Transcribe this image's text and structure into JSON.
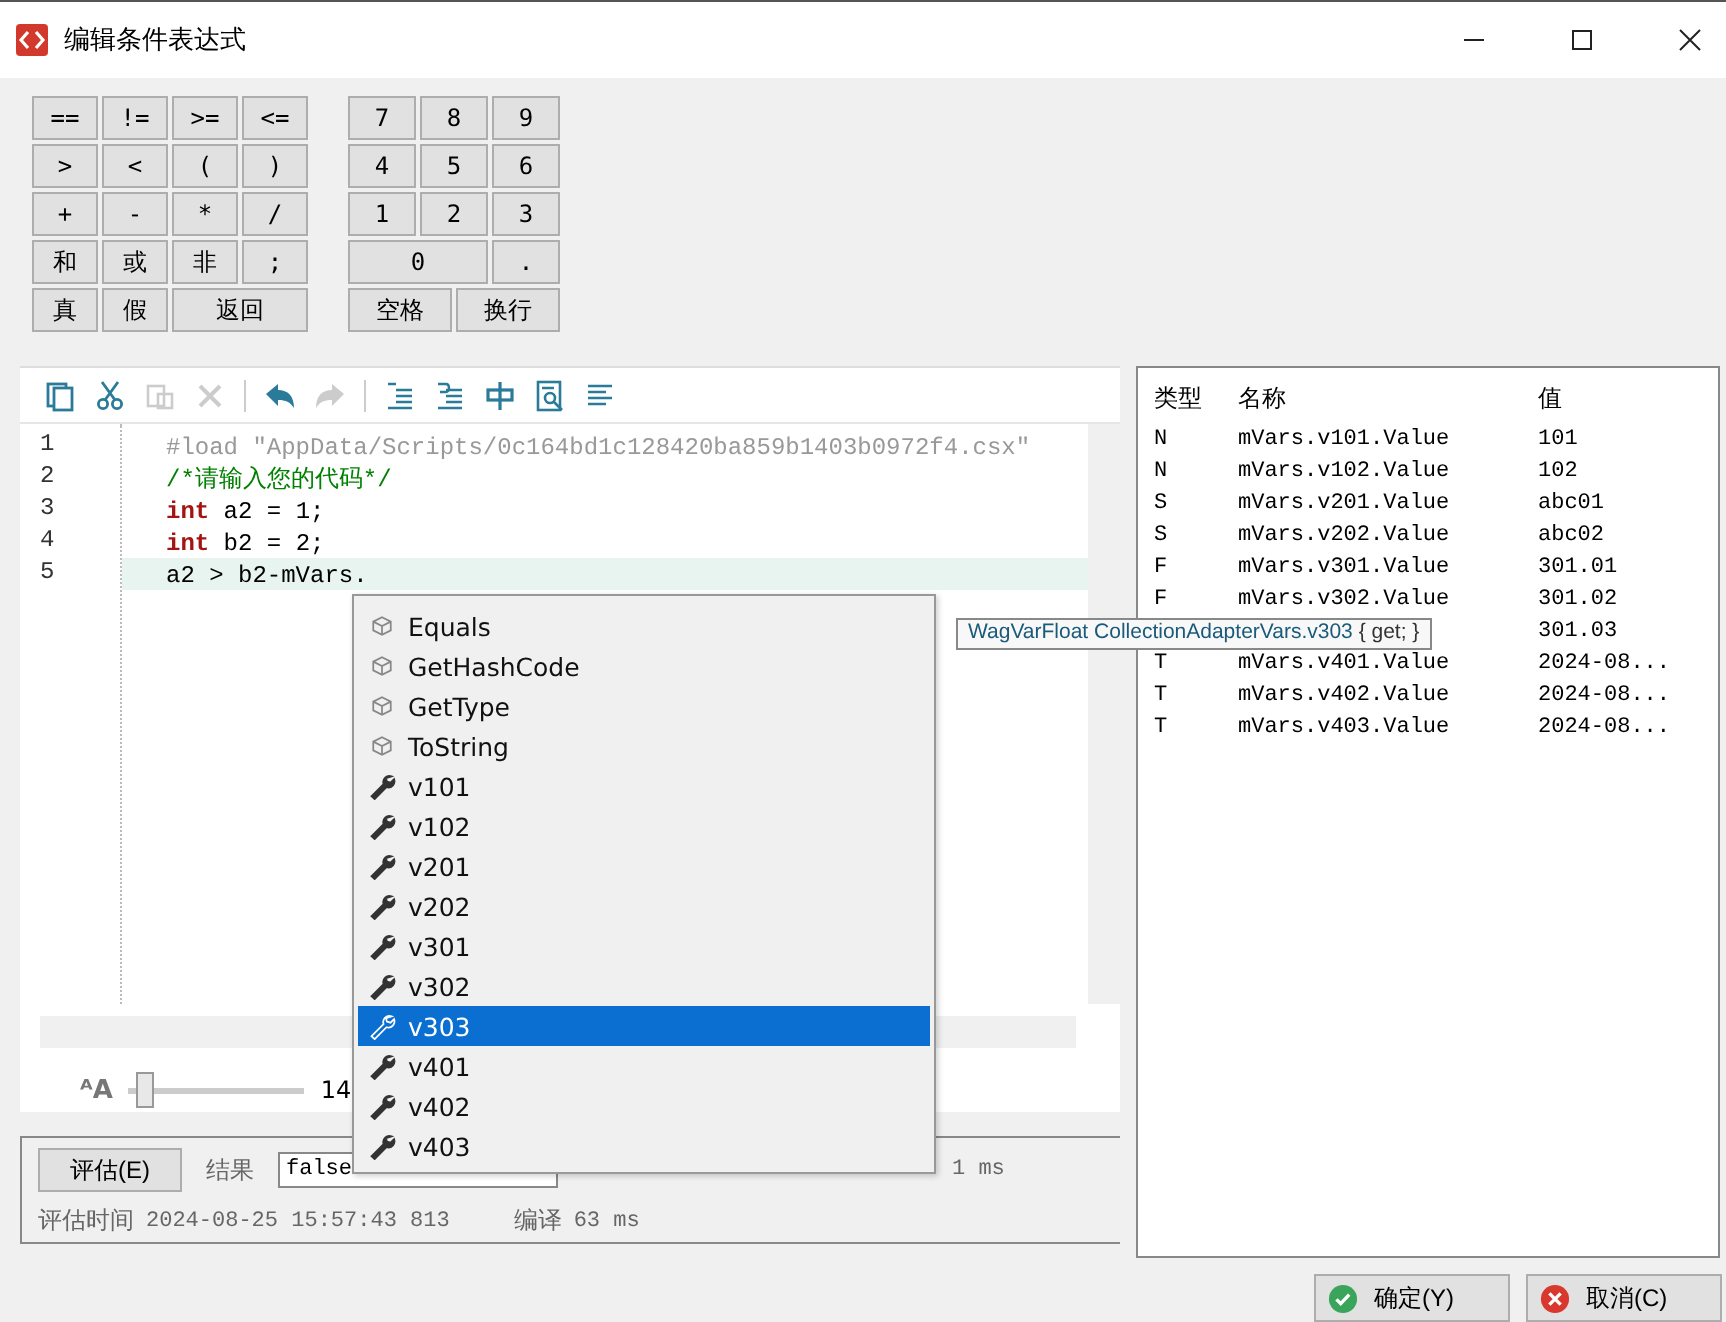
{
  "window": {
    "title": "编辑条件表达式"
  },
  "keypad_left": [
    {
      "label": "==",
      "kind": "normal"
    },
    {
      "label": "!=",
      "kind": "normal"
    },
    {
      "label": ">=",
      "kind": "normal"
    },
    {
      "label": "<=",
      "kind": "normal"
    },
    {
      "label": ">",
      "kind": "normal"
    },
    {
      "label": "<",
      "kind": "normal"
    },
    {
      "label": "(",
      "kind": "normal"
    },
    {
      "label": ")",
      "kind": "normal"
    },
    {
      "label": "+",
      "kind": "normal"
    },
    {
      "label": "-",
      "kind": "normal"
    },
    {
      "label": "*",
      "kind": "normal"
    },
    {
      "label": "/",
      "kind": "normal"
    },
    {
      "label": "和",
      "kind": "normal"
    },
    {
      "label": "或",
      "kind": "normal"
    },
    {
      "label": "非",
      "kind": "normal"
    },
    {
      "label": ";",
      "kind": "normal"
    },
    {
      "label": "真",
      "kind": "normal"
    },
    {
      "label": "假",
      "kind": "normal"
    },
    {
      "label": "返回",
      "kind": "wide"
    }
  ],
  "keypad_right": [
    {
      "label": "7",
      "kind": "normal"
    },
    {
      "label": "8",
      "kind": "normal"
    },
    {
      "label": "9",
      "kind": "normal"
    },
    {
      "label": "4",
      "kind": "normal"
    },
    {
      "label": "5",
      "kind": "normal"
    },
    {
      "label": "6",
      "kind": "normal"
    },
    {
      "label": "1",
      "kind": "normal"
    },
    {
      "label": "2",
      "kind": "normal"
    },
    {
      "label": "3",
      "kind": "normal"
    },
    {
      "label": "0",
      "kind": "wide"
    },
    {
      "label": ".",
      "kind": "normal"
    },
    {
      "label": "空格",
      "kind": "half"
    },
    {
      "label": "换行",
      "kind": "half"
    }
  ],
  "toolbar": [
    {
      "disabled": false
    },
    {
      "disabled": false
    },
    {
      "disabled": true
    },
    {
      "disabled": true
    },
    {
      "disabled": false
    },
    {
      "disabled": true
    },
    {
      "disabled": false
    },
    {
      "disabled": false
    },
    {
      "disabled": false
    },
    {
      "disabled": false
    },
    {
      "disabled": false
    }
  ],
  "editor": {
    "lines": [
      {
        "number": "1",
        "current": false,
        "tokens": [
          {
            "kind": "directive",
            "text": "#load \"AppData/Scripts/0c164bd1c128420ba859b1403b0972f4.csx\""
          }
        ]
      },
      {
        "number": "2",
        "current": false,
        "tokens": [
          {
            "kind": "comment",
            "text": "/*请输入您的代码*/"
          }
        ]
      },
      {
        "number": "3",
        "current": false,
        "tokens": [
          {
            "kind": "keyword",
            "text": "int"
          },
          {
            "kind": "plain",
            "text": " a2 = 1;"
          }
        ]
      },
      {
        "number": "4",
        "current": false,
        "tokens": [
          {
            "kind": "keyword",
            "text": "int"
          },
          {
            "kind": "plain",
            "text": " b2 = 2;"
          }
        ]
      },
      {
        "number": "5",
        "current": true,
        "tokens": [
          {
            "kind": "plain",
            "text": "a2 > b2-mVars."
          }
        ]
      }
    ],
    "font_size": {
      "icon_label": "ᴬA",
      "level": 0.04,
      "reading": "14"
    }
  },
  "completion": {
    "items": [
      {
        "label": "Equals",
        "kind": "method",
        "selected": false
      },
      {
        "label": "GetHashCode",
        "kind": "method",
        "selected": false
      },
      {
        "label": "GetType",
        "kind": "method",
        "selected": false
      },
      {
        "label": "ToString",
        "kind": "method",
        "selected": false
      },
      {
        "label": "v101",
        "kind": "property",
        "selected": false
      },
      {
        "label": "v102",
        "kind": "property",
        "selected": false
      },
      {
        "label": "v201",
        "kind": "property",
        "selected": false
      },
      {
        "label": "v202",
        "kind": "property",
        "selected": false
      },
      {
        "label": "v301",
        "kind": "property",
        "selected": false
      },
      {
        "label": "v302",
        "kind": "property",
        "selected": false
      },
      {
        "label": "v303",
        "kind": "property",
        "selected": true
      },
      {
        "label": "v401",
        "kind": "property",
        "selected": false
      },
      {
        "label": "v402",
        "kind": "property",
        "selected": false
      },
      {
        "label": "v403",
        "kind": "property",
        "selected": false
      }
    ],
    "tooltip": {
      "type": "WagVarFloat CollectionAdapterVars.v303",
      "accessor": "{ get; }"
    }
  },
  "variables": {
    "columns": [
      "类型",
      "名称",
      "值"
    ],
    "rows": [
      {
        "type": "N",
        "name": "mVars.v101.Value",
        "value": "101"
      },
      {
        "type": "N",
        "name": "mVars.v102.Value",
        "value": "102"
      },
      {
        "type": "S",
        "name": "mVars.v201.Value",
        "value": "abc01"
      },
      {
        "type": "S",
        "name": "mVars.v202.Value",
        "value": "abc02"
      },
      {
        "type": "F",
        "name": "mVars.v301.Value",
        "value": "301.01"
      },
      {
        "type": "F",
        "name": "mVars.v302.Value",
        "value": "301.02"
      },
      {
        "value": "301.03"
      },
      {
        "type": "T",
        "name": "mVars.v401.Value",
        "value": "2024-08..."
      },
      {
        "type": "T",
        "name": "mVars.v402.Value",
        "value": "2024-08..."
      },
      {
        "type": "T",
        "name": "mVars.v403.Value",
        "value": "2024-08..."
      }
    ]
  },
  "evaluation": {
    "button": "评估(E)",
    "result_label": "结果",
    "result_value": "false",
    "duration": "1 ms",
    "time_label": "评估时间",
    "time_value": "2024-08-25 15:57:43 813",
    "compile_label": "编译",
    "compile_value": "63 ms"
  },
  "buttons": [
    {
      "label": "确定(Y)",
      "kind": "ok"
    },
    {
      "label": "取消(C)",
      "kind": "cancel"
    }
  ]
}
